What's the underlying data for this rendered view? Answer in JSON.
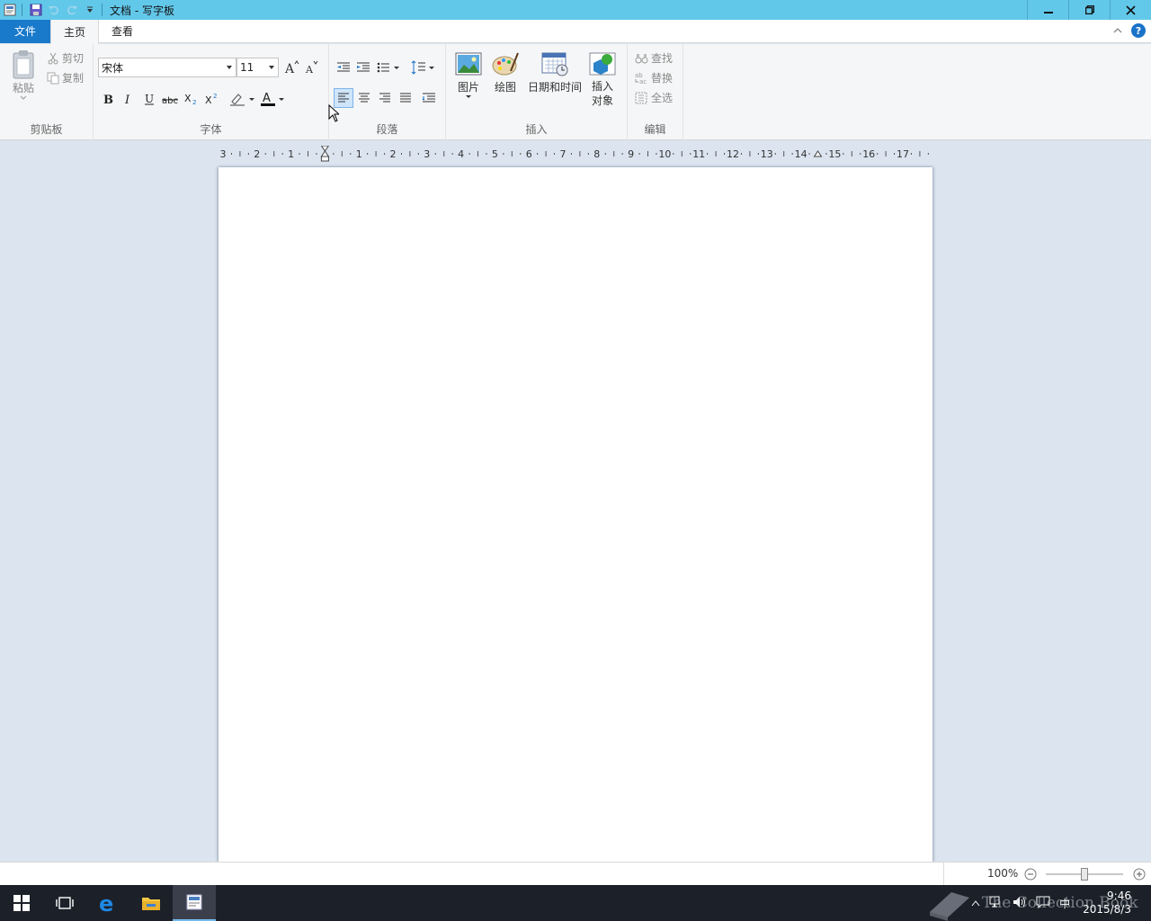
{
  "titlebar": {
    "title": "文档 - 写字板",
    "qat_icons": [
      "app-icon",
      "save-icon",
      "undo-icon",
      "redo-icon",
      "customize-qat-icon"
    ],
    "buttons": [
      "minimize",
      "restore",
      "close"
    ]
  },
  "tabs": [
    {
      "label": "文件"
    },
    {
      "label": "主页"
    },
    {
      "label": "查看"
    }
  ],
  "ribbon": {
    "clipboard": {
      "label": "剪贴板",
      "paste": "粘贴",
      "cut": "剪切",
      "copy": "复制"
    },
    "font": {
      "label": "字体",
      "family": "宋体",
      "size": "11"
    },
    "paragraph": {
      "label": "段落"
    },
    "insert": {
      "label": "插入",
      "picture": "图片",
      "paint": "绘图",
      "datetime": "日期和时间",
      "object_line1": "插入",
      "object_line2": "对象"
    },
    "edit": {
      "label": "编辑",
      "find": "查找",
      "replace": "替换",
      "selectall": "全选"
    }
  },
  "ruler": {
    "labels": [
      "3",
      "2",
      "1",
      "",
      "1",
      "2",
      "3",
      "4",
      "5",
      "6",
      "7",
      "8",
      "9",
      "10",
      "11",
      "12",
      "13",
      "14",
      "15",
      "16",
      "17"
    ]
  },
  "statusbar": {
    "zoom": "100%",
    "zoom_level": 1.0
  },
  "taskbar": {
    "items": [
      "start-button",
      "task-view-button",
      "edge-button",
      "file-explorer-button",
      "wordpad-button"
    ],
    "time": "9:46",
    "date": "2015/8/3",
    "ime": "中",
    "watermark": "The Collection Book"
  },
  "colors": {
    "titlebar": "#62c8ea",
    "file_tab": "#1979ca",
    "ribbon_bg": "#f5f6f7",
    "doc_bg": "#dbe4ef",
    "taskbar": "#1c2029"
  }
}
